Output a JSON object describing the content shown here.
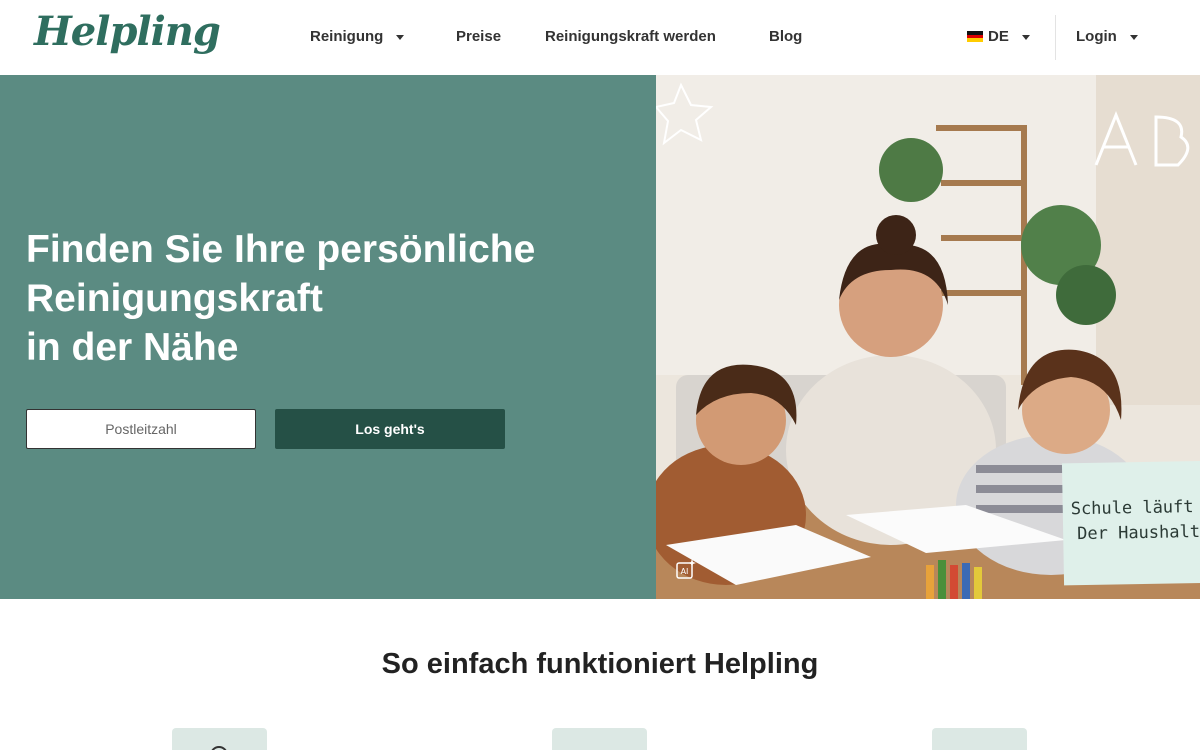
{
  "header": {
    "logo": "Helpling",
    "nav": [
      {
        "label": "Reinigung",
        "dropdown": true
      },
      {
        "label": "Preise",
        "dropdown": false
      },
      {
        "label": "Reinigungskraft werden",
        "dropdown": false
      },
      {
        "label": "Blog",
        "dropdown": false
      }
    ],
    "language": "DE",
    "login": "Login"
  },
  "hero": {
    "title_line1": "Finden Sie Ihre persönliche",
    "title_line2": "Reinigungskraft",
    "title_line3": "in der Nähe",
    "zip_placeholder": "Postleitzahl",
    "cta": "Los geht's",
    "note_line1": "Schule läuft wi",
    "note_line2": "Der Haushalt",
    "ai_badge": "AI"
  },
  "section": {
    "title": "So einfach funktioniert Helpling"
  },
  "colors": {
    "brand": "#2f6e5f",
    "hero_bg": "#5b8b82",
    "cta_bg": "#255046"
  }
}
